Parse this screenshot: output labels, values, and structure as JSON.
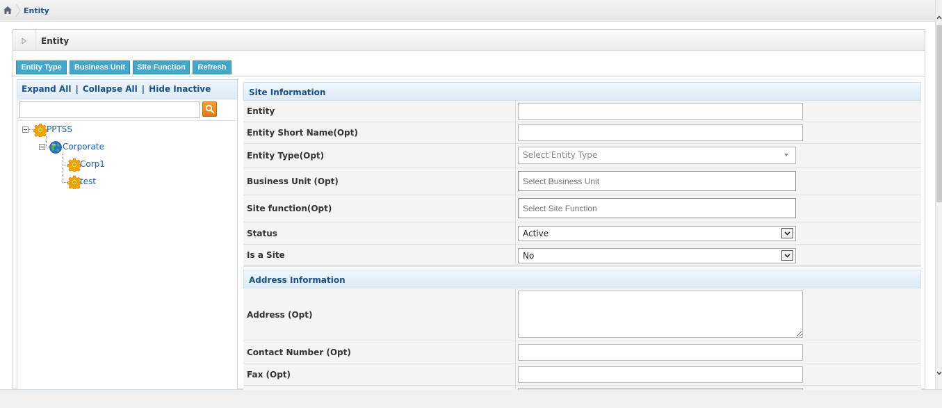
{
  "breadcrumb": {
    "current": "Entity"
  },
  "panel": {
    "title": "Entity"
  },
  "toolbar": {
    "entity_type": "Entity Type",
    "business_unit": "Business Unit",
    "site_function": "Site Function",
    "refresh": "Refresh"
  },
  "tree": {
    "expand_all": "Expand All",
    "collapse_all": "Collapse All",
    "hide_inactive": "Hide Inactive",
    "separator": "|",
    "search_value": "",
    "nodes": [
      {
        "label": "PPTSS",
        "icon": "gear-icon"
      },
      {
        "label": "Corporate",
        "icon": "globe-icon"
      },
      {
        "label": "Corp1",
        "icon": "gear-icon"
      },
      {
        "label": "test",
        "icon": "gear-icon"
      }
    ]
  },
  "site_info": {
    "heading": "Site Information",
    "entity_label": "Entity",
    "entity_value": "",
    "short_name_label": "Entity Short Name(Opt)",
    "short_name_value": "",
    "entity_type_label": "Entity Type(Opt)",
    "entity_type_placeholder": "Select Entity Type",
    "business_unit_label": "Business Unit (Opt)",
    "business_unit_placeholder": "Select Business Unit",
    "site_function_label": "Site function(Opt)",
    "site_function_placeholder": "Select Site Function",
    "status_label": "Status",
    "status_value": "Active",
    "is_site_label": "Is a Site",
    "is_site_value": "No"
  },
  "address_info": {
    "heading": "Address Information",
    "address_label": "Address (Opt)",
    "address_value": "",
    "contact_label": "Contact Number (Opt)",
    "contact_value": "",
    "fax_label": "Fax (Opt)",
    "fax_value": ""
  },
  "colors": {
    "toolbar_button": "#42a7c8",
    "link_blue": "#1b4f86",
    "tree_text": "#1a62b3",
    "search_button": "#e6780c"
  }
}
